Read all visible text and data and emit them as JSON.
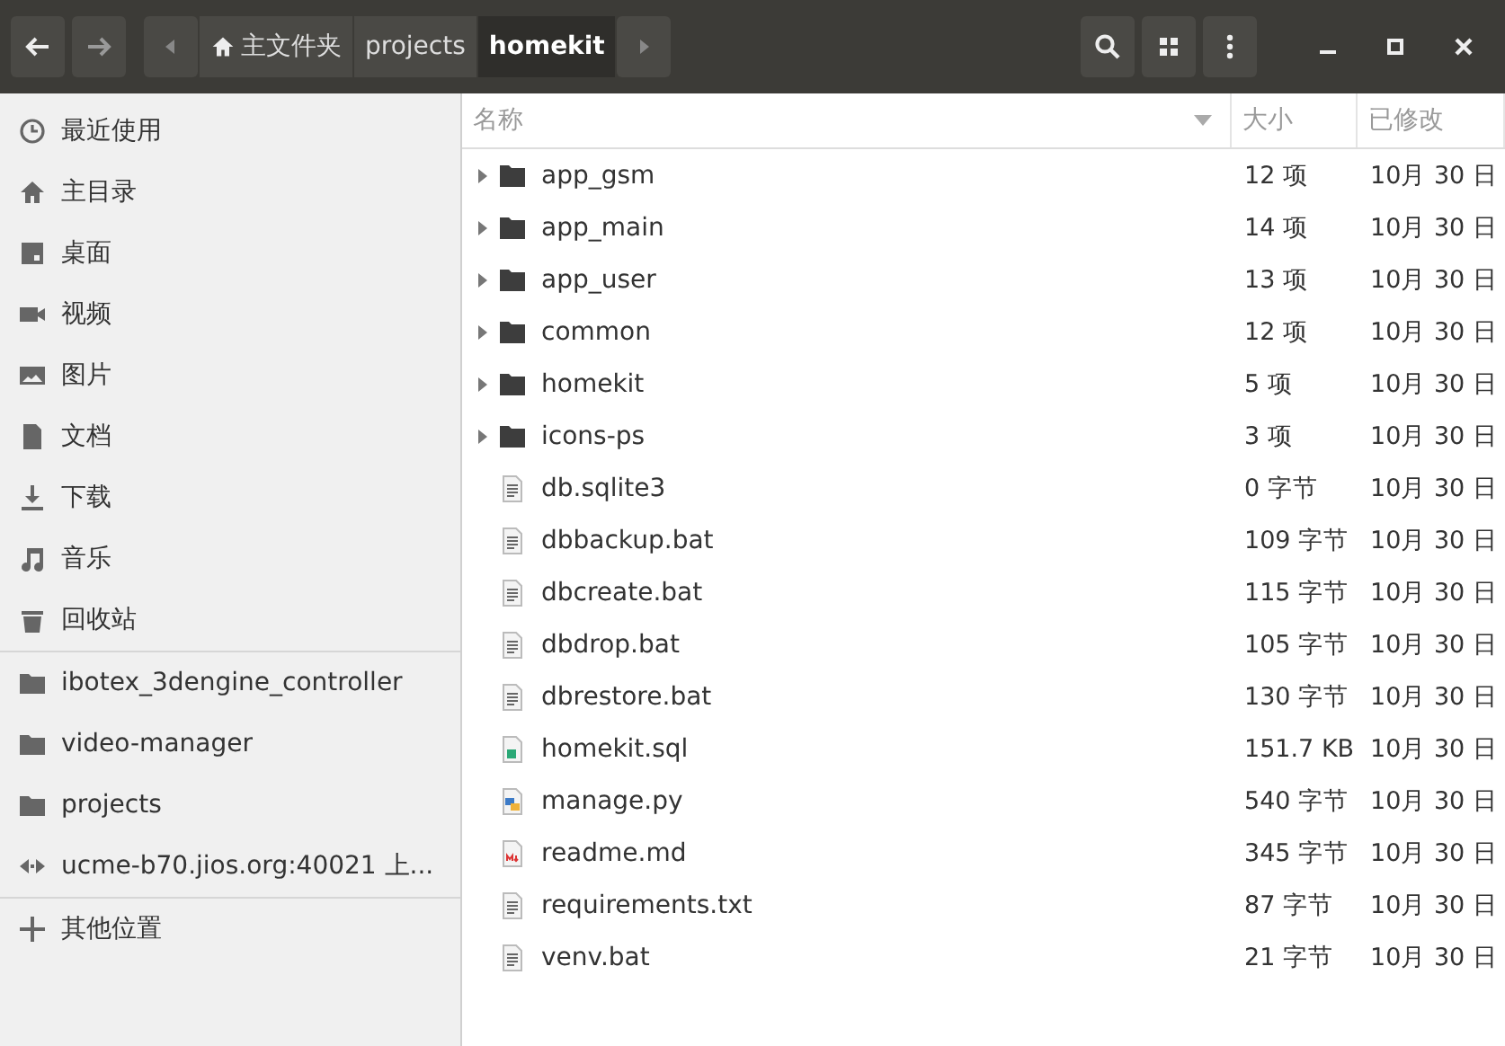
{
  "toolbar": {
    "breadcrumbs": [
      {
        "label": "主文件夹",
        "kind": "home",
        "selected": false
      },
      {
        "label": "projects",
        "kind": "folder",
        "selected": false
      },
      {
        "label": "homekit",
        "kind": "folder",
        "selected": true
      }
    ]
  },
  "sidebar": {
    "sections": [
      [
        {
          "label": "最近使用",
          "kind": "recent"
        },
        {
          "label": "主目录",
          "kind": "home"
        },
        {
          "label": "桌面",
          "kind": "desktop"
        },
        {
          "label": "视频",
          "kind": "video"
        },
        {
          "label": "图片",
          "kind": "pictures"
        },
        {
          "label": "文档",
          "kind": "documents"
        },
        {
          "label": "下载",
          "kind": "downloads"
        },
        {
          "label": "音乐",
          "kind": "music"
        },
        {
          "label": "回收站",
          "kind": "trash"
        }
      ],
      [
        {
          "label": "ibotex_3dengine_controller",
          "kind": "folder"
        },
        {
          "label": "video-manager",
          "kind": "folder"
        },
        {
          "label": "projects",
          "kind": "folder"
        },
        {
          "label": "ucme-b70.jios.org:40021 上...",
          "kind": "network"
        }
      ],
      [
        {
          "label": "其他位置",
          "kind": "add"
        }
      ]
    ]
  },
  "table": {
    "columns": [
      "名称",
      "大小",
      "已修改"
    ],
    "rows": [
      {
        "name": "app_gsm",
        "kind": "folder",
        "expanded": false,
        "size": "12 项",
        "modified": "10月 30 日"
      },
      {
        "name": "app_main",
        "kind": "folder",
        "expanded": false,
        "size": "14 项",
        "modified": "10月 30 日"
      },
      {
        "name": "app_user",
        "kind": "folder",
        "expanded": false,
        "size": "13 项",
        "modified": "10月 30 日"
      },
      {
        "name": "common",
        "kind": "folder",
        "expanded": false,
        "size": "12 项",
        "modified": "10月 30 日"
      },
      {
        "name": "homekit",
        "kind": "folder",
        "expanded": false,
        "size": "5 项",
        "modified": "10月 30 日"
      },
      {
        "name": "icons-ps",
        "kind": "folder",
        "expanded": false,
        "size": "3 项",
        "modified": "10月 30 日"
      },
      {
        "name": "db.sqlite3",
        "kind": "text",
        "size": "0 字节",
        "modified": "10月 30 日"
      },
      {
        "name": "dbbackup.bat",
        "kind": "text",
        "size": "109 字节",
        "modified": "10月 30 日"
      },
      {
        "name": "dbcreate.bat",
        "kind": "text",
        "size": "115 字节",
        "modified": "10月 30 日"
      },
      {
        "name": "dbdrop.bat",
        "kind": "text",
        "size": "105 字节",
        "modified": "10月 30 日"
      },
      {
        "name": "dbrestore.bat",
        "kind": "text",
        "size": "130 字节",
        "modified": "10月 30 日"
      },
      {
        "name": "homekit.sql",
        "kind": "sql",
        "size": "151.7 KB",
        "modified": "10月 30 日"
      },
      {
        "name": "manage.py",
        "kind": "python",
        "size": "540 字节",
        "modified": "10月 30 日"
      },
      {
        "name": "readme.md",
        "kind": "markdown",
        "size": "345 字节",
        "modified": "10月 30 日"
      },
      {
        "name": "requirements.txt",
        "kind": "text",
        "size": "87 字节",
        "modified": "10月 30 日"
      },
      {
        "name": "venv.bat",
        "kind": "text",
        "size": "21 字节",
        "modified": "10月 30 日"
      }
    ]
  }
}
